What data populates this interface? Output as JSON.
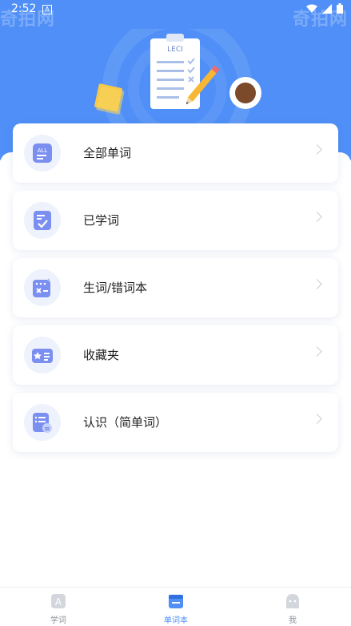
{
  "status_bar": {
    "time": "2:52",
    "notif_letter": "A"
  },
  "watermark": {
    "text": "奇拍网"
  },
  "hero": {
    "clipboard_text": "LECI"
  },
  "menu": [
    {
      "label": "全部单词",
      "icon": "all-words-icon"
    },
    {
      "label": "已学词",
      "icon": "learned-check-icon"
    },
    {
      "label": "生词/错词本",
      "icon": "wrong-words-icon"
    },
    {
      "label": "收藏夹",
      "icon": "favorites-card-icon"
    },
    {
      "label": "认识（简单词）",
      "icon": "known-words-icon"
    }
  ],
  "bottom_nav": [
    {
      "label": "学词",
      "icon": "learn-icon",
      "active": false
    },
    {
      "label": "单词本",
      "icon": "wordbook-icon",
      "active": true
    },
    {
      "label": "我",
      "icon": "profile-icon",
      "active": false
    }
  ],
  "colors": {
    "primary": "#4f8ff7",
    "icon_fill": "#7b8ff0",
    "icon_bg": "#eef2fc",
    "inactive": "#8d929b"
  }
}
